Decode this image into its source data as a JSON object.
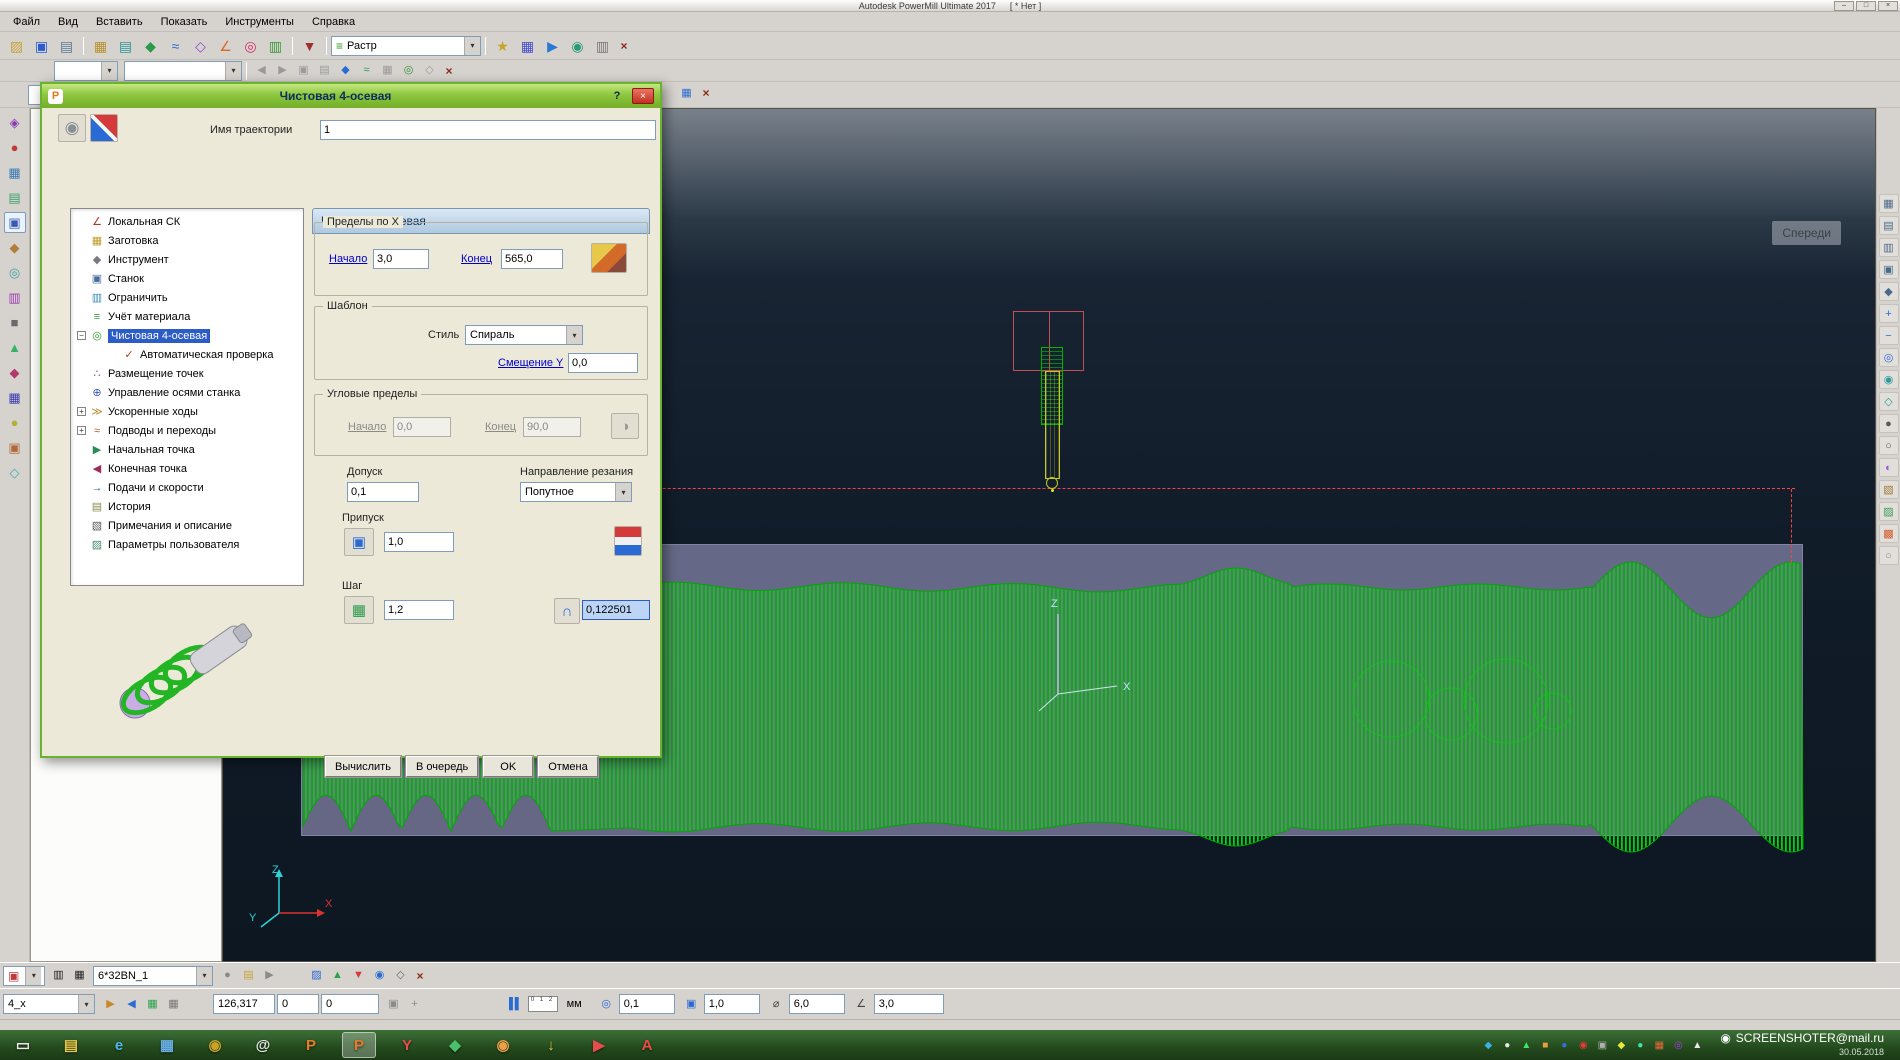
{
  "ui": {
    "caret": "▾",
    "close": "×"
  },
  "window": {
    "title": "Autodesk PowerMill Ultimate 2017",
    "status": "[ * Нет ]",
    "min": "–",
    "max": "□",
    "close": "×"
  },
  "menu": [
    {
      "label": "Файл",
      "name": "menu-file"
    },
    {
      "label": "Вид",
      "name": "menu-view"
    },
    {
      "label": "Вставить",
      "name": "menu-insert"
    },
    {
      "label": "Показать",
      "name": "menu-display"
    },
    {
      "label": "Инструменты",
      "name": "menu-tools"
    },
    {
      "label": "Справка",
      "name": "menu-help"
    }
  ],
  "tb1": {
    "raster": "Растр",
    "raster_icon": "≡",
    "g1": [
      {
        "name": "open-project-icon",
        "glyph": "▨",
        "color": "#c8a23a"
      },
      {
        "name": "save-project-icon",
        "glyph": "▣",
        "color": "#2a5ad4"
      },
      {
        "name": "print-icon",
        "glyph": "▤",
        "color": "#5a7a9a"
      }
    ],
    "g2": [
      {
        "name": "block-toolbar-icon",
        "glyph": "▦",
        "color": "#b8922f"
      },
      {
        "name": "rapid-heights-icon",
        "glyph": "▤",
        "color": "#2a9a9a"
      },
      {
        "name": "start-endpoint-icon",
        "glyph": "◆",
        "color": "#2a9a4a"
      },
      {
        "name": "pattern-toolbar-icon",
        "glyph": "≈",
        "color": "#2a6ad4"
      },
      {
        "name": "boundary-toolbar-icon",
        "glyph": "◇",
        "color": "#8a4ad4"
      },
      {
        "name": "workplane-toolbar-icon",
        "glyph": "∠",
        "color": "#d46a2a"
      },
      {
        "name": "toolpath-toolbar-icon",
        "glyph": "◎",
        "color": "#d42a6a"
      },
      {
        "name": "ncprogram-toolbar-icon",
        "glyph": "▥",
        "color": "#3a9a3a"
      }
    ],
    "g3": [
      {
        "name": "tool-toolbar-icon",
        "glyph": "▼",
        "color": "#a03030"
      }
    ],
    "g4": [
      {
        "name": "strategies-icon",
        "glyph": "★",
        "color": "#c8a22a"
      },
      {
        "name": "calculator-icon",
        "glyph": "▦",
        "color": "#4a4ad4"
      },
      {
        "name": "simulation-toolbar-icon",
        "glyph": "▶",
        "color": "#2a7ad4"
      },
      {
        "name": "viewmill-toolbar-icon",
        "glyph": "◉",
        "color": "#2a9a7a"
      },
      {
        "name": "stats-icon",
        "glyph": "▥",
        "color": "#7a7a7a"
      }
    ]
  },
  "tb2": {
    "icons": [
      {
        "name": "undo-icon",
        "glyph": "◀",
        "color": "#9a9a9a"
      },
      {
        "name": "redo-icon",
        "glyph": "▶",
        "color": "#9a9a9a"
      },
      {
        "name": "copy-icon",
        "glyph": "▣",
        "color": "#9a9a9a"
      },
      {
        "name": "paste-icon",
        "glyph": "▤",
        "color": "#9a9a9a"
      },
      {
        "name": "boundary-edit-icon",
        "glyph": "◆",
        "color": "#2a6ad4"
      },
      {
        "name": "curve-editor-icon",
        "glyph": "≈",
        "color": "#2a9a4a"
      },
      {
        "name": "grid-icon",
        "glyph": "▦",
        "color": "#9a9a9a"
      },
      {
        "name": "cloud-icon",
        "glyph": "◎",
        "color": "#3a8a3a"
      },
      {
        "name": "scissors-icon",
        "glyph": "◇",
        "color": "#9a9a9a"
      }
    ]
  },
  "tb3": {
    "frag": [
      {
        "name": "grid-frag-icon",
        "glyph": "▦",
        "color": "#2a6ad4"
      }
    ]
  },
  "left_strip": [
    {
      "name": "models-strip-icon",
      "glyph": "◈",
      "color": "#8a3ab0"
    },
    {
      "name": "toolpaths-strip-icon",
      "glyph": "●",
      "color": "#c03a3a"
    },
    {
      "name": "tools-strip-icon",
      "glyph": "▦",
      "color": "#3a7ab0"
    },
    {
      "name": "boundaries-strip-icon",
      "glyph": "▤",
      "color": "#3aa06a"
    },
    {
      "name": "patterns-strip-icon",
      "glyph": "▣",
      "color": "#3a5ab0",
      "active": true
    },
    {
      "name": "workplanes-strip-icon",
      "glyph": "◆",
      "color": "#b0803a"
    },
    {
      "name": "levels-strip-icon",
      "glyph": "◎",
      "color": "#3aa0a0"
    },
    {
      "name": "stock-models-strip-icon",
      "glyph": "▥",
      "color": "#a03ab0"
    },
    {
      "name": "groups-strip-icon",
      "glyph": "■",
      "color": "#6a6a6a"
    },
    {
      "name": "macros-strip-icon",
      "glyph": "▲",
      "color": "#3ab06a"
    },
    {
      "name": "ncprograms-strip-icon",
      "glyph": "◆",
      "color": "#b03a6a"
    },
    {
      "name": "features-strip-icon",
      "glyph": "▦",
      "color": "#3a3ab0"
    },
    {
      "name": "simulation-strip-icon",
      "glyph": "●",
      "color": "#b0b03a"
    },
    {
      "name": "viewmill-strip-icon",
      "glyph": "▣",
      "color": "#b06a3a"
    },
    {
      "name": "clipboard-strip-icon",
      "glyph": "◇",
      "color": "#3ab0b0"
    }
  ],
  "right_strip": [
    {
      "name": "view-resize-icon",
      "glyph": "▦",
      "color": "#4a6a8a"
    },
    {
      "name": "view-top-icon",
      "glyph": "▤",
      "color": "#4a6a8a"
    },
    {
      "name": "view-front-icon",
      "glyph": "▥",
      "color": "#4a6a8a"
    },
    {
      "name": "view-side-icon",
      "glyph": "▣",
      "color": "#4a6a8a"
    },
    {
      "name": "view-iso-icon",
      "glyph": "◆",
      "color": "#4a6a8a"
    },
    {
      "name": "zoom-in-icon",
      "glyph": "+",
      "color": "#2a6ad4"
    },
    {
      "name": "zoom-out-icon",
      "glyph": "−",
      "color": "#2a6ad4"
    },
    {
      "name": "zoom-fit-icon",
      "glyph": "◎",
      "color": "#2a6ad4"
    },
    {
      "name": "rotate-view-icon",
      "glyph": "◉",
      "color": "#2a9a9a"
    },
    {
      "name": "pan-view-icon",
      "glyph": "◇",
      "color": "#2a9a9a"
    },
    {
      "name": "shade-view-icon",
      "glyph": "●",
      "color": "#5a5a5a"
    },
    {
      "name": "wireframe-view-icon",
      "glyph": "○",
      "color": "#5a5a5a"
    },
    {
      "name": "multicolor-view-icon",
      "glyph": "◐",
      "color": "#9a5ad4"
    },
    {
      "name": "draw-block-icon",
      "glyph": "▧",
      "color": "#9a7a3a"
    },
    {
      "name": "draw-tool-icon",
      "glyph": "▨",
      "color": "#3a9a5a"
    },
    {
      "name": "draw-toolpath-icon",
      "glyph": "▩",
      "color": "#d45a2a"
    },
    {
      "name": "refresh-view-icon",
      "glyph": "○",
      "color": "#8a8a8a"
    }
  ],
  "dialog": {
    "brand": "P",
    "title": "Чистовая 4-осевая",
    "help": "?",
    "name_label": "Имя траектории",
    "name_value": "1",
    "header": "Чистовая 4-осевая",
    "tree": [
      {
        "label": "Локальная СК",
        "name": "tree-item-local-cs",
        "glyph": "∠",
        "color": "#b03a2a"
      },
      {
        "label": "Заготовка",
        "name": "tree-item-block",
        "glyph": "▦",
        "color": "#c09a2a"
      },
      {
        "label": "Инструмент",
        "name": "tree-item-tool",
        "glyph": "◆",
        "color": "#7a7a84"
      },
      {
        "label": "Станок",
        "name": "tree-item-machine",
        "glyph": "▣",
        "color": "#4a6a9a"
      },
      {
        "label": "Ограничить",
        "name": "tree-item-limit",
        "glyph": "▥",
        "color": "#3a8aba"
      },
      {
        "label": "Учёт материала",
        "name": "tree-item-stock-engagement",
        "glyph": "≡",
        "color": "#3a9a4a"
      },
      {
        "label": "Чистовая 4-осевая",
        "name": "tree-item-strategy",
        "glyph": "◎",
        "color": "#2a9a2a",
        "selected": true,
        "exp": "−"
      },
      {
        "label": "Автоматическая проверка",
        "name": "tree-item-auto-check",
        "glyph": "✓",
        "color": "#b03a2a",
        "child": true
      },
      {
        "label": "Размещение точек",
        "name": "tree-item-point-distribution",
        "glyph": "∴",
        "color": "#9a4aa0"
      },
      {
        "label": "Управление осями станка",
        "name": "tree-item-axis-control",
        "glyph": "⊕",
        "color": "#3a5ab0"
      },
      {
        "label": "Ускоренные ходы",
        "name": "tree-item-rapid-moves",
        "glyph": "≫",
        "color": "#c08a2a",
        "exp": "+"
      },
      {
        "label": "Подводы и переходы",
        "name": "tree-item-leads-links",
        "glyph": "≈",
        "color": "#b05a2a",
        "exp": "+"
      },
      {
        "label": "Начальная точка",
        "name": "tree-item-start-point",
        "glyph": "▶",
        "color": "#2a8a5a"
      },
      {
        "label": "Конечная точка",
        "name": "tree-item-end-point",
        "glyph": "◀",
        "color": "#a02a5a"
      },
      {
        "label": "Подачи и скорости",
        "name": "tree-item-feeds-speeds",
        "glyph": "→",
        "color": "#2a5ab0"
      },
      {
        "label": "История",
        "name": "tree-item-history",
        "glyph": "▤",
        "color": "#8a8a4a"
      },
      {
        "label": "Примечания и описание",
        "name": "tree-item-notes",
        "glyph": "▧",
        "color": "#5a5a5a"
      },
      {
        "label": "Параметры пользователя",
        "name": "tree-item-user-parameters",
        "glyph": "▨",
        "color": "#4a8a6a"
      }
    ],
    "limits": {
      "legend": "Пределы по X",
      "start_label": "Начало",
      "start_value": "3,0",
      "end_label": "Конец",
      "end_value": "565,0"
    },
    "pattern": {
      "legend": "Шаблон",
      "style_label": "Стиль",
      "style_value": "Спираль",
      "offset_label": "Смещение Y",
      "offset_value": "0,0"
    },
    "angular": {
      "legend": "Угловые пределы",
      "start_label": "Начало",
      "start_value": "0,0",
      "end_label": "Конец",
      "end_value": "90,0"
    },
    "tolerance_label": "Допуск",
    "tolerance_value": "0,1",
    "direction_label": "Направление резания",
    "direction_value": "Попутное",
    "thickness_label": "Припуск",
    "thickness_value": "1,0",
    "step_label": "Шаг",
    "step_value": "1,2",
    "cusp_value": "0,122501",
    "buttons": [
      {
        "label": "Вычислить",
        "name": "calculate-button"
      },
      {
        "label": "В очередь",
        "name": "queue-button"
      },
      {
        "label": "OK",
        "name": "ok-button"
      },
      {
        "label": "Отмена",
        "name": "cancel-button"
      }
    ]
  },
  "viewport": {
    "view_label": "Спереди",
    "axis_x": "X",
    "axis_y": "Y",
    "axis_z": "Z"
  },
  "sb1": {
    "combo_icon": "▣",
    "combo_icon_color": "#c03a3a",
    "grid_icons": [
      {
        "name": "tool-db-icon",
        "glyph": "▥",
        "color": "#222222"
      },
      {
        "name": "tool-table-icon",
        "glyph": "▦",
        "color": "#222222"
      }
    ],
    "tool_name": "6*32BN_1",
    "mid_icons": [
      {
        "name": "tool-shadow-icon",
        "glyph": "●",
        "color": "#8a8a8a"
      },
      {
        "name": "tool-nc-icon",
        "glyph": "▤",
        "color": "#c8a23a"
      },
      {
        "name": "fly-icon",
        "glyph": "▶",
        "color": "#8a8a8a"
      }
    ],
    "right_icons": [
      {
        "name": "edit-toolpath-icon",
        "glyph": "▨",
        "color": "#2a6ad4"
      },
      {
        "name": "flag-green-icon",
        "glyph": "▲",
        "color": "#2aa04a"
      },
      {
        "name": "flag-red-icon",
        "glyph": "▼",
        "color": "#d43a3a"
      },
      {
        "name": "search-icon",
        "glyph": "◉",
        "color": "#2a6ad4"
      },
      {
        "name": "wrench-icon",
        "glyph": "◇",
        "color": "#6a6a6a"
      }
    ]
  },
  "sb2": {
    "axis_mode": "4_x",
    "left_icons": [
      {
        "name": "probe-next-icon",
        "glyph": "▶",
        "color": "#c8872a"
      },
      {
        "name": "probe-prev-icon",
        "glyph": "◀",
        "color": "#2a6ad4"
      },
      {
        "name": "block-small-icon",
        "glyph": "▦",
        "color": "#2aa04a"
      },
      {
        "name": "grid-toggle-icon",
        "glyph": "▦",
        "color": "#777777",
        "active": true
      },
      {
        "name": "blank-button",
        "glyph": "",
        "color": "#999999"
      }
    ],
    "x": "126,317",
    "y": "0",
    "z": "0",
    "lock_icons": [
      {
        "name": "snap-icon",
        "glyph": "▣",
        "color": "#8a8a8a"
      },
      {
        "name": "compass-icon",
        "glyph": "+",
        "color": "#8a8a8a"
      }
    ],
    "pause_icon": "▌▌",
    "ruler": "0 1 2",
    "units": "мм",
    "crosshair_icon": "◎",
    "tolerance": "0,1",
    "thickness_icon": "▣",
    "thickness": "1,0",
    "diameter_icon": "⌀",
    "diameter": "6,0",
    "angle_icon": "∠",
    "angle": "3,0"
  },
  "taskbar": {
    "apps": [
      {
        "name": "show-desktop-button",
        "glyph": "▭",
        "color": "#e8e8e8"
      },
      {
        "name": "explorer-app-icon",
        "glyph": "▤",
        "color": "#e8c84b"
      },
      {
        "name": "internet-explorer-icon",
        "glyph": "e",
        "color": "#4bb8e8"
      },
      {
        "name": "calculator-app-icon",
        "glyph": "▦",
        "color": "#6ab0e8"
      },
      {
        "name": "chrome-icon",
        "glyph": "◉",
        "color": "#c8a22a"
      },
      {
        "name": "mail-agent-icon",
        "glyph": "@",
        "color": "#e8e8e8"
      },
      {
        "name": "powermill-taskbar-icon",
        "glyph": "P",
        "color": "#e87a2b"
      },
      {
        "name": "powermill-active-icon",
        "glyph": "P",
        "color": "#e87a2b",
        "active": true
      },
      {
        "name": "yandex-browser-icon",
        "glyph": "Y",
        "color": "#e84b4b"
      },
      {
        "name": "powershape-icon",
        "glyph": "◆",
        "color": "#4bc06a"
      },
      {
        "name": "firefox-icon",
        "glyph": "◉",
        "color": "#e8a04b"
      },
      {
        "name": "download-master-icon",
        "glyph": "↓",
        "color": "#e8c84b"
      },
      {
        "name": "media-player-icon",
        "glyph": "▶",
        "color": "#e84b4b"
      },
      {
        "name": "adobe-reader-icon",
        "glyph": "A",
        "color": "#e84b4b"
      }
    ],
    "tray": [
      {
        "name": "tray-icon-1",
        "glyph": "◆",
        "color": "#3ab0e8"
      },
      {
        "name": "tray-icon-2",
        "glyph": "●",
        "color": "#e8e8e8"
      },
      {
        "name": "tray-icon-3",
        "glyph": "▲",
        "color": "#3ae86a"
      },
      {
        "name": "tray-icon-4",
        "glyph": "■",
        "color": "#e8a03a"
      },
      {
        "name": "tray-icon-5",
        "glyph": "●",
        "color": "#3a6ae8"
      },
      {
        "name": "tray-icon-6",
        "glyph": "◉",
        "color": "#e83a3a"
      },
      {
        "name": "tray-icon-7",
        "glyph": "▣",
        "color": "#b0b0b0"
      },
      {
        "name": "tray-icon-8",
        "glyph": "◆",
        "color": "#e8e83a"
      },
      {
        "name": "tray-icon-9",
        "glyph": "●",
        "color": "#3ae8b0"
      },
      {
        "name": "tray-icon-10",
        "glyph": "▦",
        "color": "#e86a3a"
      },
      {
        "name": "tray-icon-11",
        "glyph": "◎",
        "color": "#b03ae8"
      },
      {
        "name": "tray-icon-12",
        "glyph": "▲",
        "color": "#e8e8e8"
      }
    ],
    "cam_icon": "◉",
    "screenshoter": "SCREENSHOTER@mail.ru",
    "date": "30.05.2018"
  }
}
